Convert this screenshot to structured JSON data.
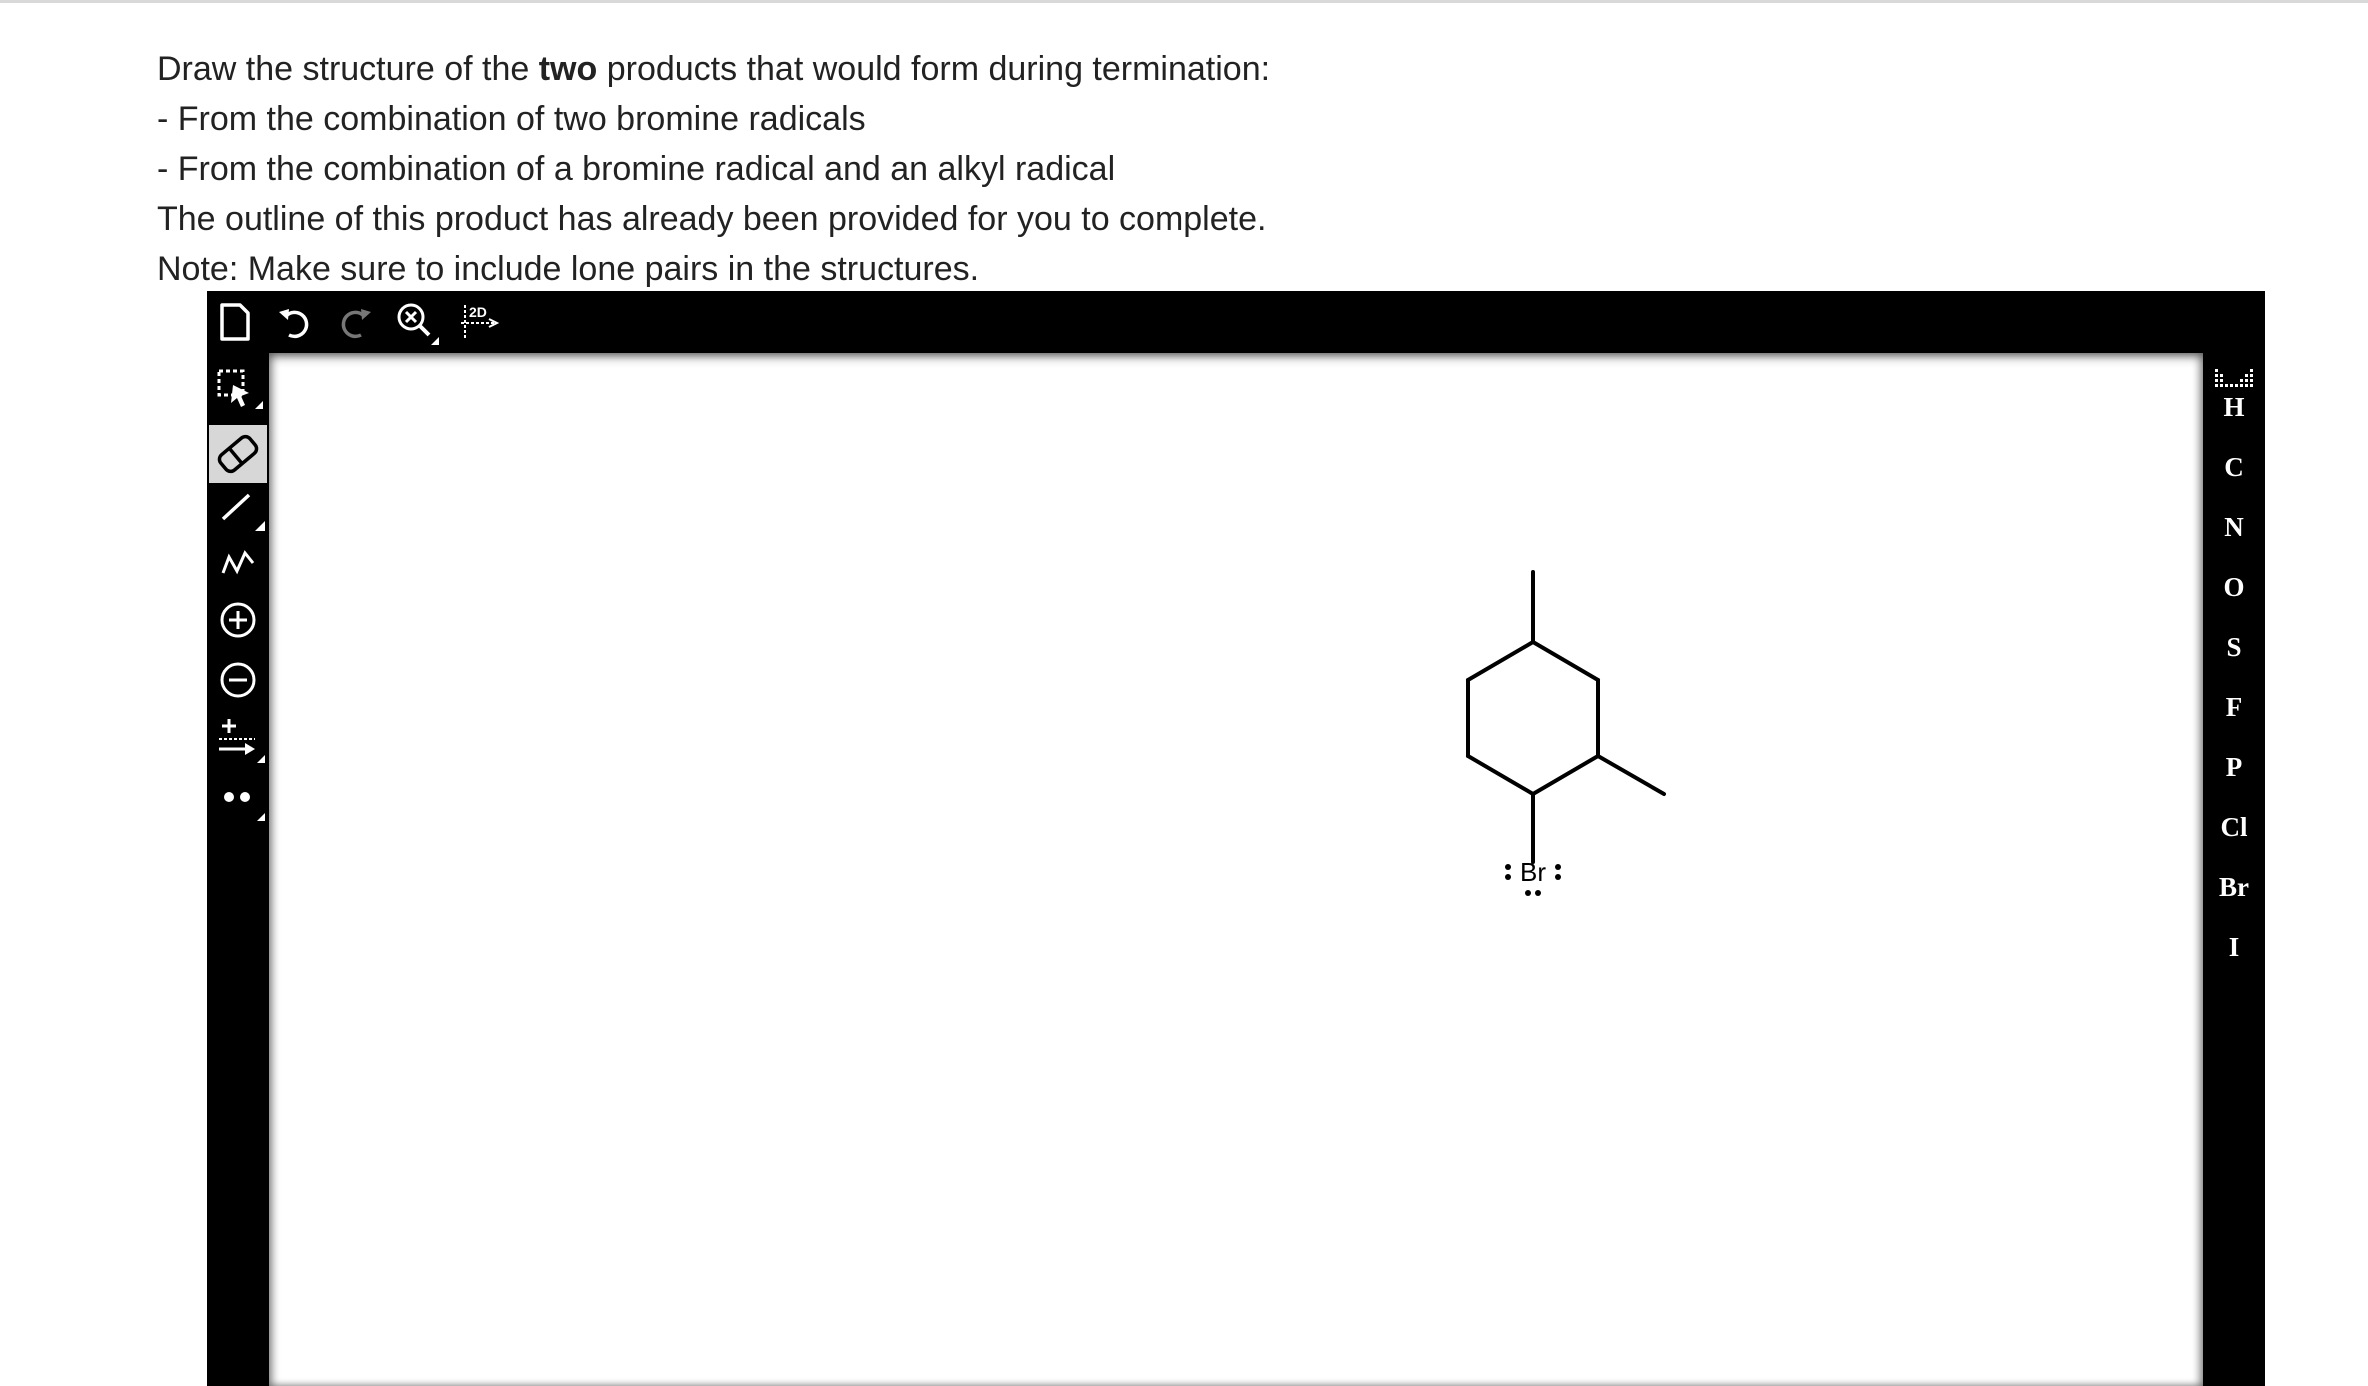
{
  "prompt": {
    "line1_before": "Draw the structure of the ",
    "line1_bold": "two",
    "line1_after": " products that would form during termination:",
    "line2": "- From the combination of two bromine radicals",
    "line3": "- From the combination of a bromine radical and an alkyl radical",
    "line4": "The outline of this product has already been provided for you to complete.",
    "line5": "Note: Make sure to include lone pairs in the structures."
  },
  "toolbar_top": {
    "icons": [
      "new-document-icon",
      "undo-icon",
      "redo-icon",
      "zoom-icon",
      "clean-2d-icon"
    ],
    "clean_label": "2D"
  },
  "toolbar_left": {
    "icons": [
      "select-tool-icon",
      "eraser-icon",
      "single-bond-icon",
      "chain-icon",
      "positive-charge-icon",
      "negative-charge-icon",
      "electron-flow-icon",
      "lone-pair-icon"
    ],
    "selected": "eraser-icon"
  },
  "elements": [
    "H",
    "C",
    "N",
    "O",
    "S",
    "F",
    "P",
    "Cl",
    "Br",
    "I"
  ],
  "molecule": {
    "atom_label": "Br"
  },
  "colors": {
    "toolbar": "#000000",
    "canvas": "#ffffff",
    "selected_tool": "#d7d7d7",
    "text": "#222222"
  }
}
